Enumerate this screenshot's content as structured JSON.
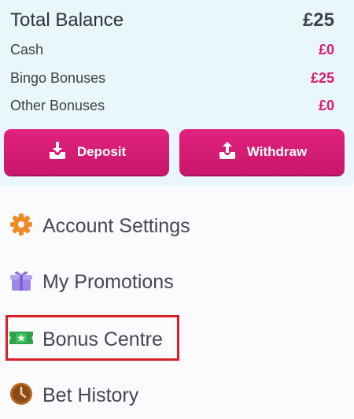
{
  "balance": {
    "total_label": "Total Balance",
    "total_value": "£25",
    "rows": [
      {
        "label": "Cash",
        "value": "£0"
      },
      {
        "label": "Bingo Bonuses",
        "value": "£25"
      },
      {
        "label": "Other Bonuses",
        "value": "£0"
      }
    ]
  },
  "actions": {
    "deposit_label": "Deposit",
    "withdraw_label": "Withdraw"
  },
  "menu": {
    "items": [
      {
        "label": "Account Settings",
        "icon": "gear-icon"
      },
      {
        "label": "My Promotions",
        "icon": "gift-icon"
      },
      {
        "label": "Bonus Centre",
        "icon": "ticket-star-icon"
      },
      {
        "label": "Bet History",
        "icon": "clock-icon"
      }
    ]
  },
  "colors": {
    "accent": "#d81b74",
    "card_bg": "#e9f7fc",
    "highlight_border": "#d81f26"
  }
}
